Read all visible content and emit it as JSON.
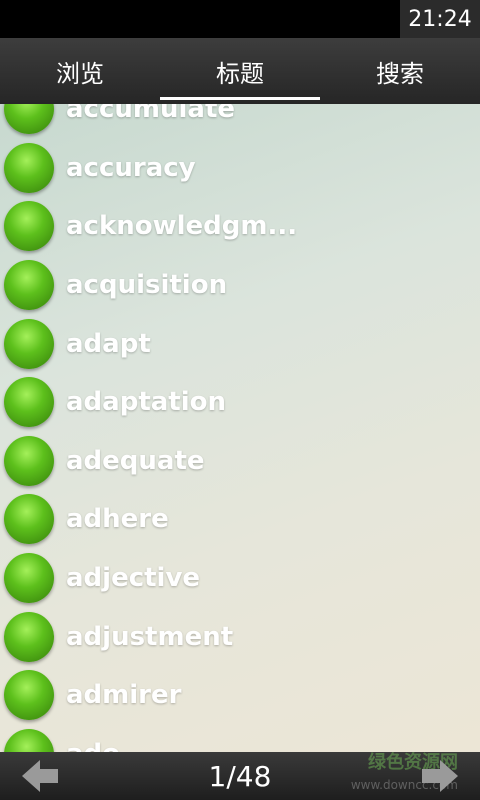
{
  "status": {
    "time": "21:24"
  },
  "tabs": [
    {
      "label": "浏览",
      "active": false
    },
    {
      "label": "标题",
      "active": true
    },
    {
      "label": "搜索",
      "active": false
    }
  ],
  "words": [
    "accumulate",
    "accuracy",
    "acknowledgm...",
    "acquisition",
    "adapt",
    "adaptation",
    "adequate",
    "adhere",
    "adjective",
    "adjustment",
    "admirer",
    "ado"
  ],
  "pager": {
    "current": "1/48"
  },
  "watermark": {
    "text": "绿色资源网",
    "sub": "www.downcc.com"
  },
  "colors": {
    "bullet": "#5dc01c",
    "bar": "#262626"
  }
}
